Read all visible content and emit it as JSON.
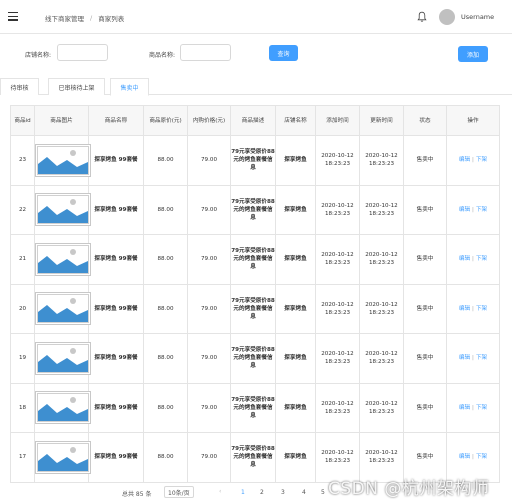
{
  "header": {
    "breadcrumb": [
      "线下商家管理",
      "商家列表"
    ],
    "separator": "/",
    "username": "Username"
  },
  "search": {
    "store_label": "店铺名称:",
    "store_value": "",
    "product_label": "商品名称:",
    "product_value": "",
    "query_button": "查询",
    "add_button": "添加"
  },
  "tabs": [
    {
      "label": "待审核",
      "active": false
    },
    {
      "label": "已审核待上架",
      "active": false
    },
    {
      "label": "售卖中",
      "active": true
    }
  ],
  "table": {
    "columns": [
      "商品id",
      "商品图片",
      "商品名称",
      "商品原价(元)",
      "内购价格(元)",
      "商品描述",
      "店铺名称",
      "添加时间",
      "更新时间",
      "状态",
      "操作"
    ],
    "rows": [
      {
        "id": "23",
        "name": "探享烤鱼 99套餐",
        "price": "88.00",
        "inner_price": "79.00",
        "desc": "79元享受原价88元的烤鱼套餐信息",
        "store": "探享烤鱼",
        "created": "2020-10-12 18:23:23",
        "updated": "2020-10-12 18:23:23",
        "status": "售卖中",
        "edit": "编辑",
        "off": "下架"
      },
      {
        "id": "22",
        "name": "探享烤鱼 99套餐",
        "price": "88.00",
        "inner_price": "79.00",
        "desc": "79元享受原价88元的烤鱼套餐信息",
        "store": "探享烤鱼",
        "created": "2020-10-12 18:23:23",
        "updated": "2020-10-12 18:23:23",
        "status": "售卖中",
        "edit": "编辑",
        "off": "下架"
      },
      {
        "id": "21",
        "name": "探享烤鱼 99套餐",
        "price": "88.00",
        "inner_price": "79.00",
        "desc": "79元享受原价88元的烤鱼套餐信息",
        "store": "探享烤鱼",
        "created": "2020-10-12 18:23:23",
        "updated": "2020-10-12 18:23:23",
        "status": "售卖中",
        "edit": "编辑",
        "off": "下架"
      },
      {
        "id": "20",
        "name": "探享烤鱼 99套餐",
        "price": "88.00",
        "inner_price": "79.00",
        "desc": "79元享受原价88元的烤鱼套餐信息",
        "store": "探享烤鱼",
        "created": "2020-10-12 18:23:23",
        "updated": "2020-10-12 18:23:23",
        "status": "售卖中",
        "edit": "编辑",
        "off": "下架"
      },
      {
        "id": "19",
        "name": "探享烤鱼 99套餐",
        "price": "88.00",
        "inner_price": "79.00",
        "desc": "79元享受原价88元的烤鱼套餐信息",
        "store": "探享烤鱼",
        "created": "2020-10-12 18:23:23",
        "updated": "2020-10-12 18:23:23",
        "status": "售卖中",
        "edit": "编辑",
        "off": "下架"
      },
      {
        "id": "18",
        "name": "探享烤鱼 99套餐",
        "price": "88.00",
        "inner_price": "79.00",
        "desc": "79元享受原价88元的烤鱼套餐信息",
        "store": "探享烤鱼",
        "created": "2020-10-12 18:23:23",
        "updated": "2020-10-12 18:23:23",
        "status": "售卖中",
        "edit": "编辑",
        "off": "下架"
      },
      {
        "id": "17",
        "name": "探享烤鱼 99套餐",
        "price": "88.00",
        "inner_price": "79.00",
        "desc": "79元享受原价88元的烤鱼套餐信息",
        "store": "探享烤鱼",
        "created": "2020-10-12 18:23:23",
        "updated": "2020-10-12 18:23:23",
        "status": "售卖中",
        "edit": "编辑",
        "off": "下架"
      }
    ]
  },
  "pagination": {
    "total": "总共 85 条",
    "page_size": "10条/页",
    "pages": [
      "1",
      "2",
      "3",
      "4",
      "5"
    ],
    "current": "1"
  },
  "watermark": "CSDN @杭州架构师",
  "icons": {
    "menu": "menu-icon",
    "bell": "bell-icon",
    "image": "image-placeholder-icon",
    "prev": "chevron-left-icon"
  },
  "colors": {
    "accent": "#409eff",
    "image_blue": "#3e8fd0",
    "image_gray": "#c8c8c8"
  }
}
